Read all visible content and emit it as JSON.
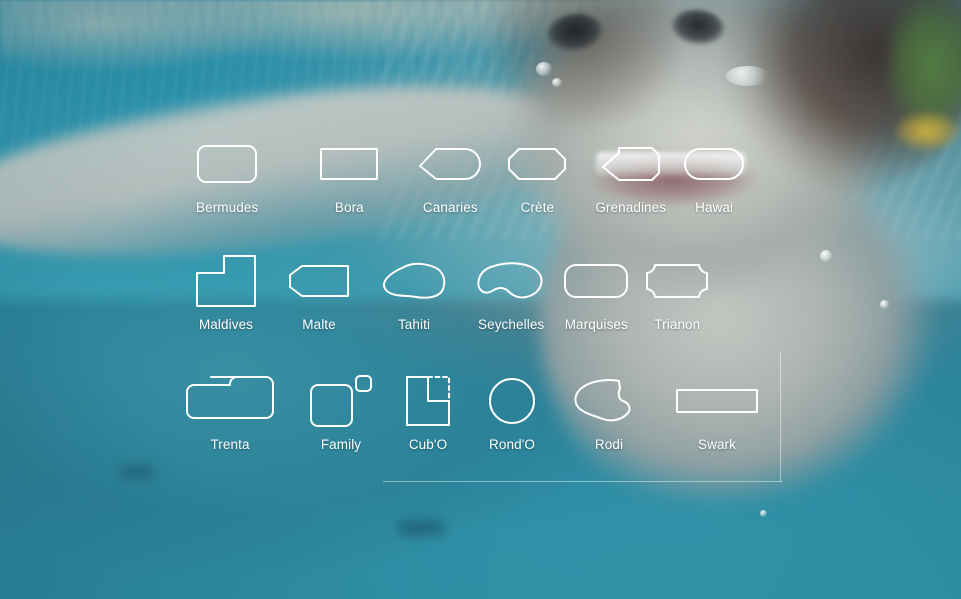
{
  "picker": {
    "rows": [
      {
        "row_name": "shape-row-1",
        "items": [
          {
            "label": "Bermudes",
            "icon": "rounded-rectangle-shape-icon",
            "gap_after": 62
          },
          {
            "label": "Bora",
            "icon": "rectangle-shape-icon",
            "gap_after": 41
          },
          {
            "label": "Canaries",
            "icon": "pointed-left-rounded-right-shape-icon",
            "gap_after": 27
          },
          {
            "label": "Crète",
            "icon": "octagon-shape-icon",
            "gap_after": 29
          },
          {
            "label": "Grenadines",
            "icon": "notched-left-polygon-shape-icon",
            "gap_after": 18
          },
          {
            "label": "Hawai",
            "icon": "stadium-shape-icon",
            "gap_after": 0
          }
        ]
      },
      {
        "row_name": "shape-row-2",
        "items": [
          {
            "label": "Maldives",
            "icon": "l-step-shape-icon",
            "gap_after": 33
          },
          {
            "label": "Malte",
            "icon": "angled-left-rectangle-shape-icon",
            "gap_after": 33
          },
          {
            "label": "Tahiti",
            "icon": "blob-shape-icon",
            "gap_after": 32
          },
          {
            "label": "Seychelles",
            "icon": "kidney-bean-shape-icon",
            "gap_after": 20
          },
          {
            "label": "Marquises",
            "icon": "rounded-rectangle-wide-shape-icon",
            "gap_after": 18
          },
          {
            "label": "Trianon",
            "icon": "concave-corner-rectangle-shape-icon",
            "gap_after": 0
          }
        ]
      },
      {
        "row_name": "shape-row-3",
        "items": [
          {
            "label": "Trenta",
            "icon": "z-step-rounded-shape-icon",
            "gap_after": 36
          },
          {
            "label": "Family",
            "icon": "square-plus-small-square-shape-icon",
            "gap_after": 34
          },
          {
            "label": "Cub'O",
            "icon": "l-shape-dashed-corner-icon",
            "gap_after": 39
          },
          {
            "label": "Rond'O",
            "icon": "circle-shape-icon",
            "gap_after": 38
          },
          {
            "label": "Rodi",
            "icon": "freeform-blob-shape-icon",
            "gap_after": 31
          },
          {
            "label": "Swark",
            "icon": "flat-wide-rectangle-shape-icon",
            "gap_after": 0
          }
        ]
      }
    ]
  },
  "dividers": {
    "horizontal_rule_name": "horizontal-divider",
    "vertical_rule_name": "vertical-divider"
  },
  "colors": {
    "stroke": "#ffffff",
    "label": "#ffffff",
    "water_teal": "#2b7f96",
    "water_light": "#35a0b5",
    "divider": "rgba(255,255,255,0.45)"
  },
  "background": {
    "description_name": "underwater-child-photo"
  }
}
